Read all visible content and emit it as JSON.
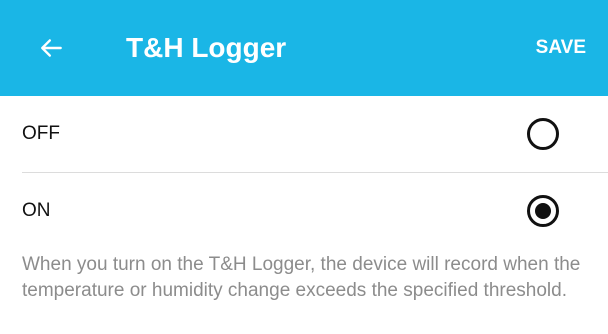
{
  "header": {
    "title": "T&H Logger",
    "save_label": "SAVE",
    "back_icon": "arrow-left-icon",
    "background_color": "#1ab6e6"
  },
  "options": [
    {
      "label": "OFF",
      "selected": false
    },
    {
      "label": "ON",
      "selected": true
    }
  ],
  "description": "When you turn on the T&H Logger, the device will record when the temperature or humidity change exceeds the specified threshold."
}
